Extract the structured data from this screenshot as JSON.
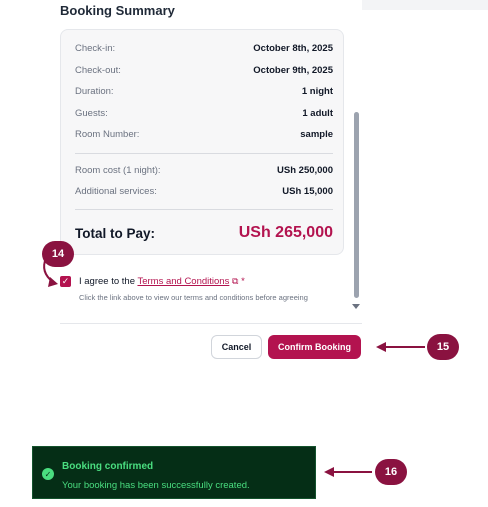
{
  "section_title": "Booking Summary",
  "summary": {
    "rows": [
      {
        "label": "Check-in:",
        "value": "October 8th, 2025"
      },
      {
        "label": "Check-out:",
        "value": "October 9th, 2025"
      },
      {
        "label": "Duration:",
        "value": "1 night"
      },
      {
        "label": "Guests:",
        "value": "1 adult"
      },
      {
        "label": "Room Number:",
        "value": "sample"
      }
    ],
    "costs": [
      {
        "label": "Room cost (1 night):",
        "value": "USh 250,000"
      },
      {
        "label": "Additional services:",
        "value": "USh 15,000"
      }
    ],
    "total_label": "Total to Pay:",
    "total_value": "USh 265,000"
  },
  "terms": {
    "prefix": "I agree to the",
    "link": "Terms and Conditions",
    "required": "*",
    "hint": "Click the link above to view our terms and conditions before agreeing",
    "checked": true
  },
  "buttons": {
    "cancel": "Cancel",
    "confirm": "Confirm Booking"
  },
  "badges": {
    "b14": "14",
    "b15": "15",
    "b16": "16"
  },
  "toast": {
    "title": "Booking confirmed",
    "message": "Your booking has been successfully created."
  },
  "colors": {
    "accent": "#b3134f",
    "badge": "#8a1240",
    "toast_bg": "#052e16",
    "toast_text": "#4ade80"
  },
  "icons": {
    "checkbox": "check-icon",
    "external": "external-link-icon",
    "toast": "success-check-icon"
  }
}
